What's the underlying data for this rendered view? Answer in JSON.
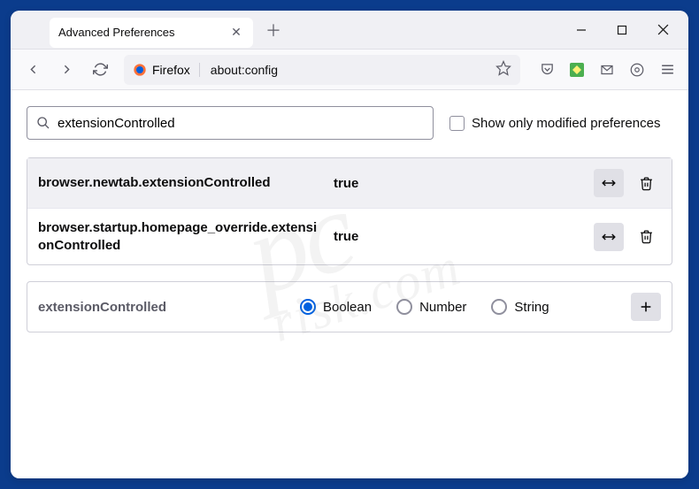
{
  "tab": {
    "title": "Advanced Preferences"
  },
  "urlbar": {
    "identity": "Firefox",
    "address": "about:config"
  },
  "search": {
    "value": "extensionControlled",
    "checkbox_label": "Show only modified preferences"
  },
  "prefs": [
    {
      "name": "browser.newtab.extensionControlled",
      "value": "true"
    },
    {
      "name": "browser.startup.homepage_override.extensionControlled",
      "value": "true"
    }
  ],
  "add": {
    "name": "extensionControlled",
    "types": [
      "Boolean",
      "Number",
      "String"
    ],
    "selected": "Boolean"
  },
  "watermark": {
    "main": "pc",
    "sub": "risk.com"
  }
}
